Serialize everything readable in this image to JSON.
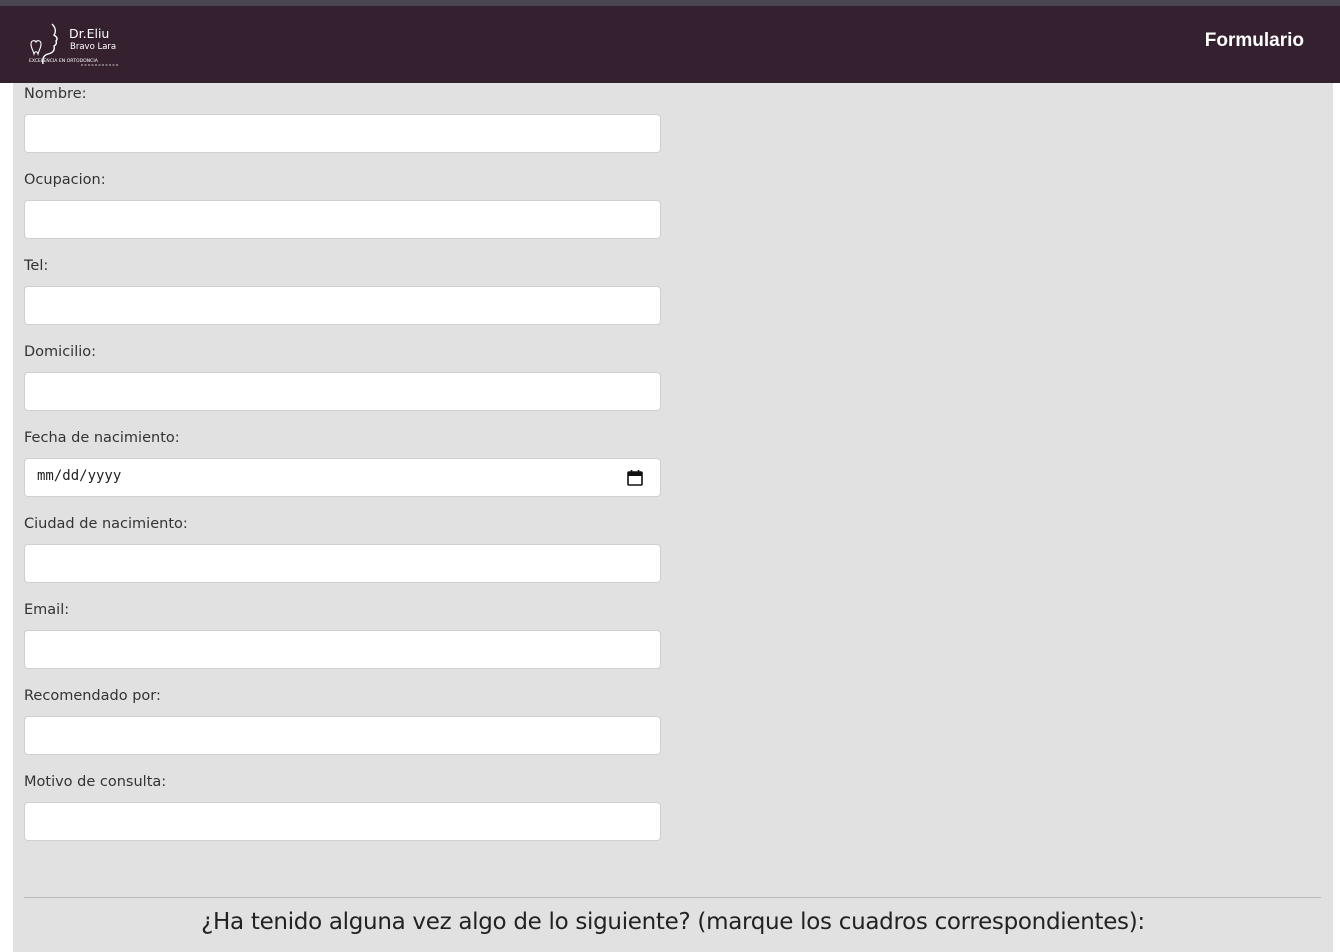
{
  "logo": {
    "name_line1": "Dr.Eliu",
    "name_line2": "Bravo Lara",
    "tagline": "EXCELENCIA EN ORTODONCIA"
  },
  "nav": {
    "link_label": "Formulario"
  },
  "form": {
    "fields": [
      {
        "label": "Nombre:",
        "value": ""
      },
      {
        "label": "Ocupacion:",
        "value": ""
      },
      {
        "label": "Tel:",
        "value": ""
      },
      {
        "label": "Domicilio:",
        "value": ""
      },
      {
        "label": "Fecha de nacimiento:",
        "placeholder": "mm/dd/yyyy"
      },
      {
        "label": "Ciudad de nacimiento:",
        "value": ""
      },
      {
        "label": "Email:",
        "value": ""
      },
      {
        "label": "Recomendado por:",
        "value": ""
      },
      {
        "label": "Motivo de consulta:",
        "value": ""
      }
    ]
  },
  "section": {
    "title": "¿Ha tenido alguna vez algo de lo siguiente? (marque los cuadros correspondientes):"
  },
  "colors": {
    "navbar": "#35202f",
    "background": "#e1e1e1"
  }
}
